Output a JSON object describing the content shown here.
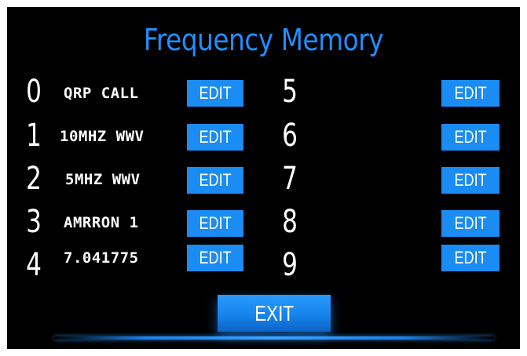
{
  "screen": {
    "title": "Frequency Memory",
    "accent_color": "#1a8cf4",
    "background_color": "#000000"
  },
  "left_slots": [
    {
      "number": "0",
      "label": "QRP CALL",
      "edit_label": "EDIT"
    },
    {
      "number": "1",
      "label": "10MHZ WWV",
      "edit_label": "EDIT"
    },
    {
      "number": "2",
      "label": "5MHZ WWV",
      "edit_label": "EDIT"
    },
    {
      "number": "3",
      "label": "AMRRON 1",
      "edit_label": "EDIT"
    },
    {
      "number": "4",
      "label": "7.041775",
      "edit_label": "EDIT"
    }
  ],
  "right_slots": [
    {
      "number": "5",
      "label": "",
      "edit_label": "EDIT"
    },
    {
      "number": "6",
      "label": "",
      "edit_label": "EDIT"
    },
    {
      "number": "7",
      "label": "",
      "edit_label": "EDIT"
    },
    {
      "number": "8",
      "label": "",
      "edit_label": "EDIT"
    },
    {
      "number": "9",
      "label": "",
      "edit_label": "EDIT"
    }
  ],
  "footer": {
    "exit_label": "EXIT"
  }
}
